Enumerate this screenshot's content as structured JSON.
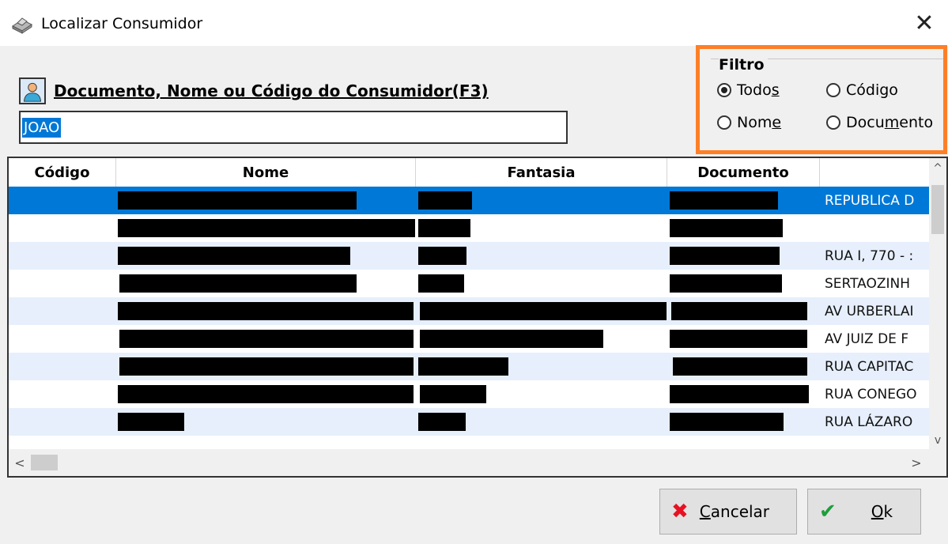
{
  "window": {
    "title": "Localizar Consumidor",
    "close_glyph": "✕",
    "icon": "cube-icon"
  },
  "search": {
    "label": "Documento, Nome ou Código do Consumidor(F3)",
    "value": "JOAO",
    "icon": "person-icon"
  },
  "filter": {
    "title": "Filtro",
    "options": [
      {
        "label_pre": "Todo",
        "label_u": "s",
        "label_post": "",
        "selected": true
      },
      {
        "label_pre": "Códi",
        "label_u": "g",
        "label_post": "o",
        "selected": false
      },
      {
        "label_pre": "Nom",
        "label_u": "e",
        "label_post": "",
        "selected": false
      },
      {
        "label_pre": "Docu",
        "label_u": "m",
        "label_post": "ento",
        "selected": false
      }
    ]
  },
  "table": {
    "columns": [
      "Código",
      "Nome",
      "Fantasia",
      "Documento",
      ""
    ],
    "rows": [
      {
        "codigo": "",
        "endereco": "REPUBLICA D",
        "selected": true
      },
      {
        "codigo": "",
        "endereco": "",
        "selected": false
      },
      {
        "codigo": "",
        "endereco": "RUA I, 770 - :",
        "selected": false
      },
      {
        "codigo": "",
        "endereco": "SERTAOZINH",
        "selected": false
      },
      {
        "codigo": "",
        "endereco": "AV URBERLAI",
        "selected": false
      },
      {
        "codigo": "",
        "endereco": "AV JUIZ DE F",
        "selected": false
      },
      {
        "codigo": "",
        "endereco": "RUA CAPITAC",
        "selected": false
      },
      {
        "codigo": "",
        "endereco": "RUA CONEGO",
        "selected": false
      },
      {
        "codigo": "",
        "endereco": "RUA LÁZARO",
        "selected": false
      }
    ],
    "scroll": {
      "up": "^",
      "down": "v",
      "left": "<",
      "right": ">"
    }
  },
  "buttons": {
    "cancel": {
      "icon_glyph": "✖",
      "label_u": "C",
      "label_rest": "ancelar",
      "color": "#e81123"
    },
    "ok": {
      "icon_glyph": "✔",
      "label_u": "O",
      "label_rest": "k",
      "color": "#1e9e3a"
    }
  }
}
